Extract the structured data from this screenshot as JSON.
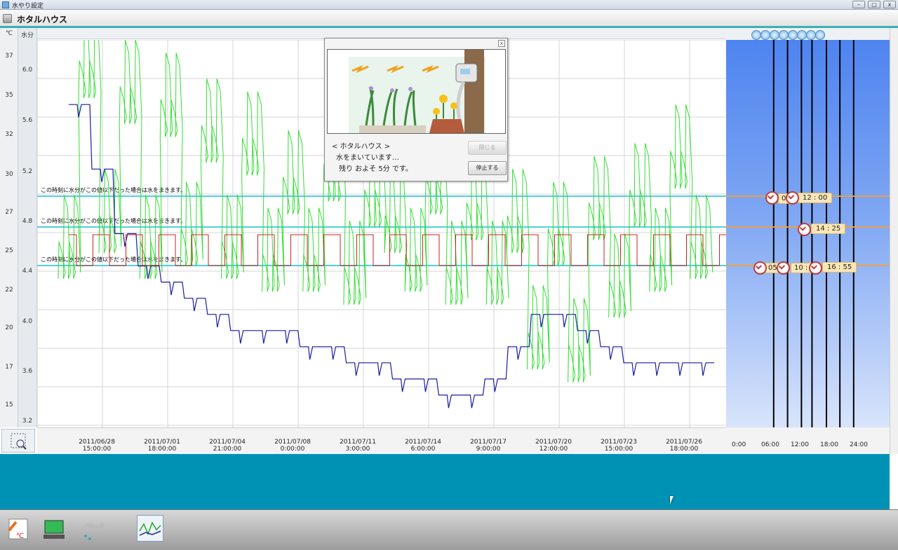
{
  "window": {
    "title": "水やり設定"
  },
  "header": {
    "title": "ホタルハウス"
  },
  "axes": {
    "temp_header": "℃",
    "moist_header": "水分",
    "temp_ticks": [
      "37",
      "35",
      "32",
      "30",
      "27",
      "25",
      "22",
      "20",
      "17",
      "15"
    ],
    "moist_ticks": [
      "6.0",
      "5.6",
      "5.2",
      "4.8",
      "4.4",
      "4.0",
      "3.6",
      "3.2"
    ],
    "x_ticks": [
      {
        "d": "2011/06/28",
        "t": "15:00:00"
      },
      {
        "d": "2011/07/01",
        "t": "18:00:00"
      },
      {
        "d": "2011/07/04",
        "t": "21:00:00"
      },
      {
        "d": "2011/07/08",
        "t": "0:00:00"
      },
      {
        "d": "2011/07/11",
        "t": "3:00:00"
      },
      {
        "d": "2011/07/14",
        "t": "6:00:00"
      },
      {
        "d": "2011/07/17",
        "t": "9:00:00"
      },
      {
        "d": "2011/07/20",
        "t": "12:00:00"
      },
      {
        "d": "2011/07/23",
        "t": "15:00:00"
      },
      {
        "d": "2011/07/26",
        "t": "18:00:00"
      }
    ]
  },
  "thresholds": [
    {
      "text": "この時刻に水分がこの値以下だった場合は水をまきます。",
      "value": 5.0
    },
    {
      "text": "この時刻に水分がこの値以下だった場合は水をまきます。",
      "value": 4.75
    },
    {
      "text": "この時刻に水分がこの値以下だった場合は水をまきます。",
      "value": 4.45
    }
  ],
  "schedule": {
    "hour_labels": [
      "0:00",
      "06:00",
      "12:00",
      "18:00",
      "24:00"
    ],
    "times": [
      {
        "label": "12 : 00",
        "hour": 12.0
      },
      {
        "label": "14 : 25",
        "hour": 14.42
      },
      {
        "label": "16 : 55",
        "hour": 16.92
      }
    ],
    "partial_labels": [
      "0",
      "05",
      "10 :"
    ]
  },
  "dialog": {
    "house_line": "< ホタルハウス >",
    "msg_line": "水をまいています…",
    "remain_line": "残り およそ 5分 です。",
    "close_label": "閉じる",
    "stop_label": "停止する"
  },
  "colors": {
    "moisture": "#33dd33",
    "temperature": "#1a1aa8",
    "setting": "#cc2222",
    "threshold": "#4fd0e0",
    "schedule_line": "#f0a040"
  },
  "chart_data": {
    "type": "line",
    "x_range": [
      "2011/06/28 15:00",
      "2011/07/27 06:00"
    ],
    "ylim_moisture": [
      3.2,
      6.2
    ],
    "ylim_temperature": [
      14,
      38
    ],
    "series": [
      {
        "values_moisture_sample": [
          4.4,
          5.8,
          4.6,
          5.6,
          4.4,
          5.5,
          4.5,
          5.3,
          4.4,
          5.2,
          4.3,
          4.9,
          4.3,
          5.0,
          4.2,
          4.8,
          4.6,
          4.3,
          4.9,
          4.2,
          4.7,
          4.2,
          4.6,
          3.7,
          4.5,
          3.6,
          4.7,
          4.1,
          4.8,
          4.3,
          5.1,
          4.4,
          5.0
        ]
      },
      {
        "values_temperature_sample": [
          34,
          30,
          26,
          24,
          23,
          22,
          21,
          20,
          20,
          20,
          19,
          19,
          18,
          18,
          17,
          17,
          16,
          16,
          17,
          19,
          21,
          21,
          20,
          19,
          18,
          18,
          18,
          18
        ]
      }
    ]
  }
}
